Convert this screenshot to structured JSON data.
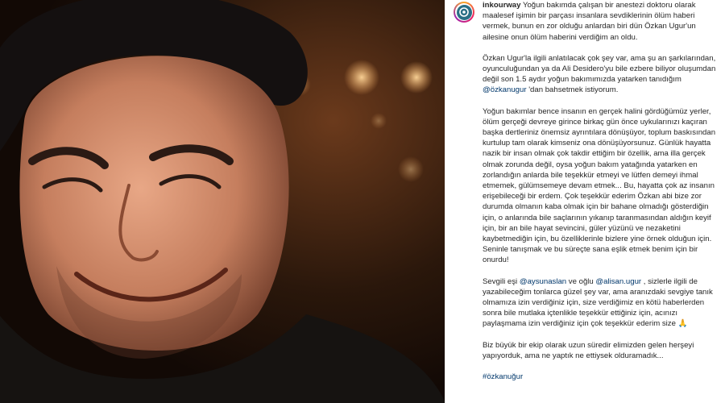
{
  "post": {
    "username": "inkourway",
    "caption": [
      {
        "segments": [
          {
            "id": "p0s0",
            "text": "Yoğun bakımda çalışan bir anestezi doktoru olarak maalesef işimin bir parçası insanlara sevdiklerinin ölüm haberi vermek, bunun en zor olduğu anlardan biri dün Özkan Ugur'un ailesine onun ölüm haberini verdiğim an oldu.",
            "kind": "text"
          }
        ]
      },
      {
        "segments": [
          {
            "id": "p1s0",
            "text": "Özkan Ugur'la ilgili anlatılacak çok şey var, ama şu an şarkılarından, oyunculuğundan ya da Ali Desidero'yu bile ezbere biliyor oluşumdan değil son 1.5 aydır yoğun bakımımızda yatarken tanıdığım ",
            "kind": "text"
          },
          {
            "id": "p1s1",
            "text": "@özkanugur",
            "kind": "mention"
          },
          {
            "id": "p1s2",
            "text": " 'dan bahsetmek istiyorum.",
            "kind": "text"
          }
        ]
      },
      {
        "segments": [
          {
            "id": "p2s0",
            "text": "Yoğun bakımlar bence insanın en gerçek halini gördüğümüz yerler, ölüm gerçeği devreye girince birkaç gün önce uykularınızı kaçıran başka dertleriniz önemsiz ayrıntılara dönüşüyor, toplum baskısından kurtulup tam olarak kimseniz ona dönüşüyorsunuz. Günlük hayatta nazik bir insan olmak çok takdir ettiğim bir özellik, ama illa gerçek olmak zorunda değil, oysa yoğun bakım yatağında yatarken en zorlandığın anlarda bile teşekkür etmeyi ve lütfen demeyi ihmal etmemek, gülümsemeye devam etmek... Bu, hayatta çok az insanın erişebileceği bir erdem. Çok teşekkür ederim Özkan abi bize zor durumda olmanın kaba olmak için bir bahane olmadığı gösterdiğin için, o anlarında bile saçlarının yıkanıp taranmasından aldığın keyif için, bir an bile hayat sevincini, güler yüzünü ve nezaketini kaybetmediğin için, bu özelliklerinle bizlere yine örnek olduğun için. Seninle tanışmak ve bu süreçte sana eşlik etmek benim için bir onurdu!",
            "kind": "text"
          }
        ]
      },
      {
        "segments": [
          {
            "id": "p3s0",
            "text": "Sevgili eşi ",
            "kind": "text"
          },
          {
            "id": "p3s1",
            "text": "@aysunaslan",
            "kind": "mention"
          },
          {
            "id": "p3s2",
            "text": " ve oğlu ",
            "kind": "text"
          },
          {
            "id": "p3s3",
            "text": "@alisan.ugur",
            "kind": "mention"
          },
          {
            "id": "p3s4",
            "text": " , sizlerle ilgili de yazabileceğim tonlarca güzel şey var, ama aranızdaki sevgiye tanık olmamıza izin verdiğiniz için, size verdiğimiz en kötü haberlerden sonra bile mutlaka içtenlikle teşekkür ettiğiniz için, acınızı paylaşmama izin verdiğiniz için çok teşekkür ederim size ",
            "kind": "text"
          },
          {
            "id": "p3s5",
            "text": "🙏",
            "kind": "emoji"
          }
        ]
      },
      {
        "segments": [
          {
            "id": "p4s0",
            "text": "Biz büyük bir ekip olarak uzun süredir elimizden gelen herşeyi yapıyorduk, ama ne yaptık ne ettiysek olduramadık...",
            "kind": "text"
          }
        ]
      },
      {
        "segments": [
          {
            "id": "p5s0",
            "text": "#özkanuğur",
            "kind": "hashtag"
          }
        ]
      }
    ]
  },
  "colors": {
    "text": "#262626",
    "link": "#00376b",
    "border": "#efefef"
  }
}
